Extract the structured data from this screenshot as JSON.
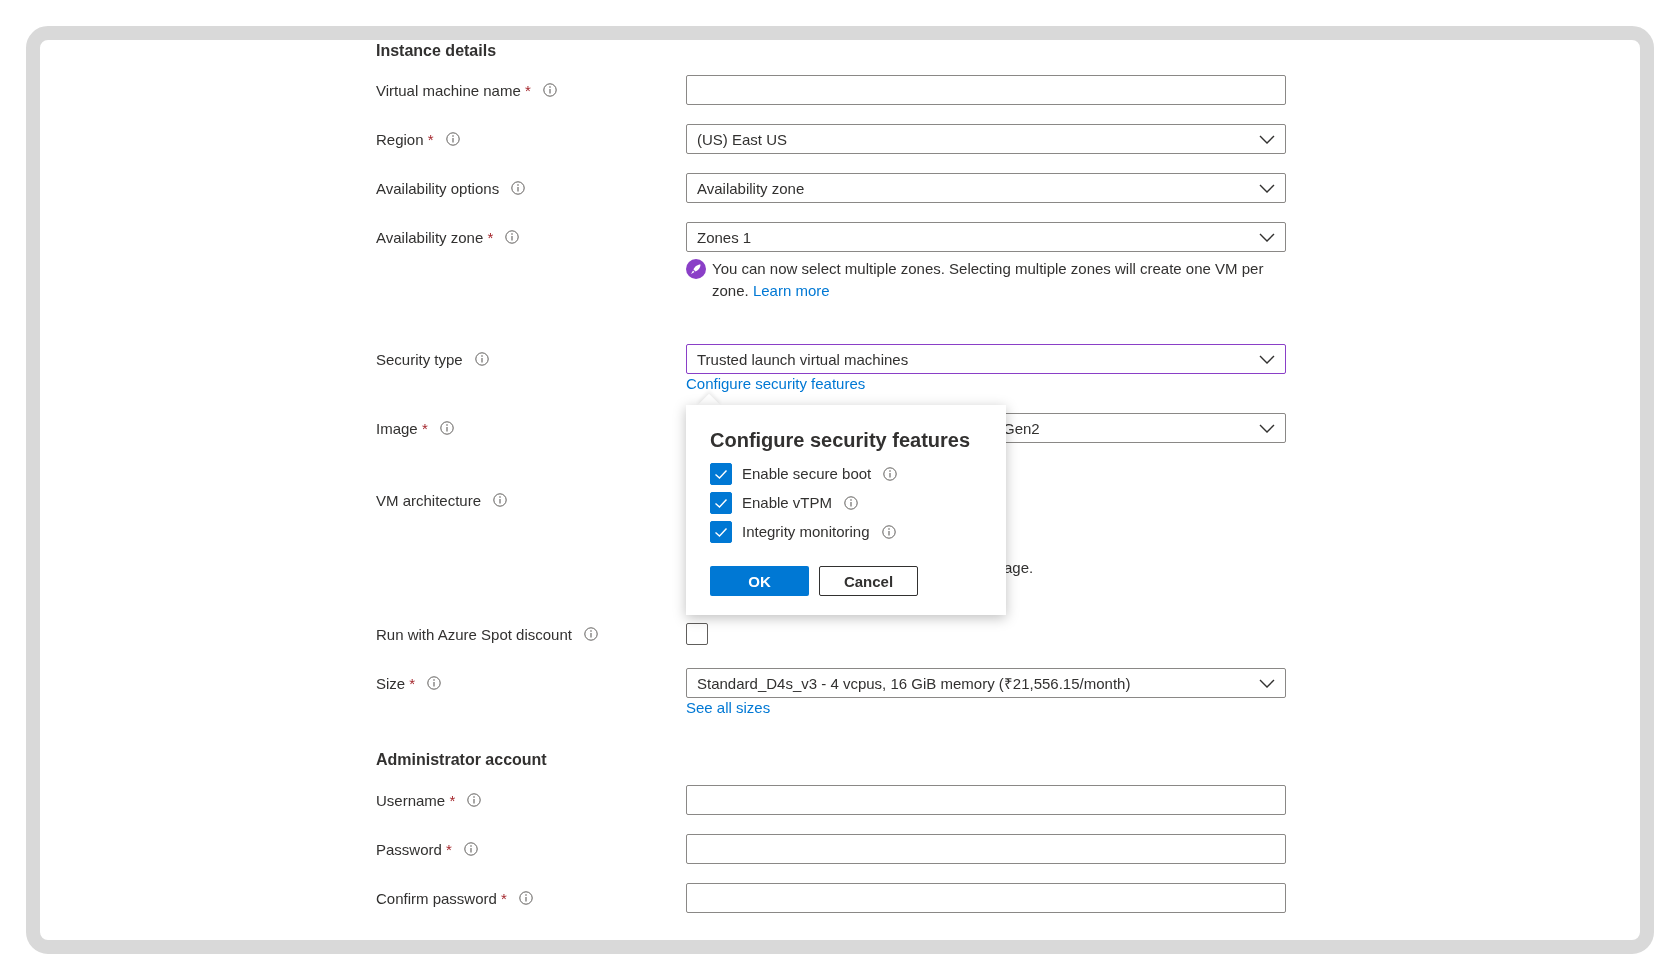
{
  "sections": [
    {
      "heading": "Instance details",
      "fields": [
        {
          "kind": "text",
          "label": "Virtual machine name",
          "required_mark": "*"
        },
        {
          "kind": "select",
          "label": "Region",
          "required_mark": "*",
          "value": "(US) East US",
          "focused": false
        },
        {
          "kind": "select",
          "label": "Availability options",
          "value": "Availability zone",
          "focused": false
        },
        {
          "kind": "select",
          "label": "Availability zone",
          "required_mark": "*",
          "value": "Zones 1",
          "focused": false,
          "info": {
            "text": "You can now select multiple zones. Selecting multiple zones will create one VM per zone.",
            "link": "Learn more"
          }
        },
        {
          "kind": "select",
          "label": "Security type",
          "value": "Trusted launch virtual machines",
          "focused": true,
          "link": "Configure security features"
        },
        {
          "kind": "select",
          "label": "Image",
          "required_mark": "*",
          "value": "Gen2",
          "focused": false,
          "partly_covered": true
        },
        {
          "kind": "covered",
          "label": "VM architecture",
          "fragment": "age."
        },
        {
          "kind": "checkbox",
          "label": "Run with Azure Spot discount",
          "checked": false
        },
        {
          "kind": "select",
          "label": "Size",
          "required_mark": "*",
          "value": "Standard_D4s_v3 - 4 vcpus, 16 GiB memory (₹21,556.15/month)",
          "focused": false,
          "link": "See all sizes"
        }
      ]
    },
    {
      "heading": "Administrator account",
      "fields": [
        {
          "kind": "text",
          "label": "Username",
          "required_mark": "*"
        },
        {
          "kind": "text",
          "label": "Password",
          "required_mark": "*"
        },
        {
          "kind": "text",
          "label": "Confirm password",
          "required_mark": "*"
        }
      ]
    }
  ],
  "popover": {
    "title": "Configure security features",
    "options": [
      {
        "label": "Enable secure boot",
        "checked": true
      },
      {
        "label": "Enable vTPM",
        "checked": true
      },
      {
        "label": "Integrity monitoring",
        "checked": true
      }
    ],
    "buttons": [
      {
        "label": "OK",
        "kind": "primary"
      },
      {
        "label": "Cancel",
        "kind": "secondary"
      }
    ]
  }
}
